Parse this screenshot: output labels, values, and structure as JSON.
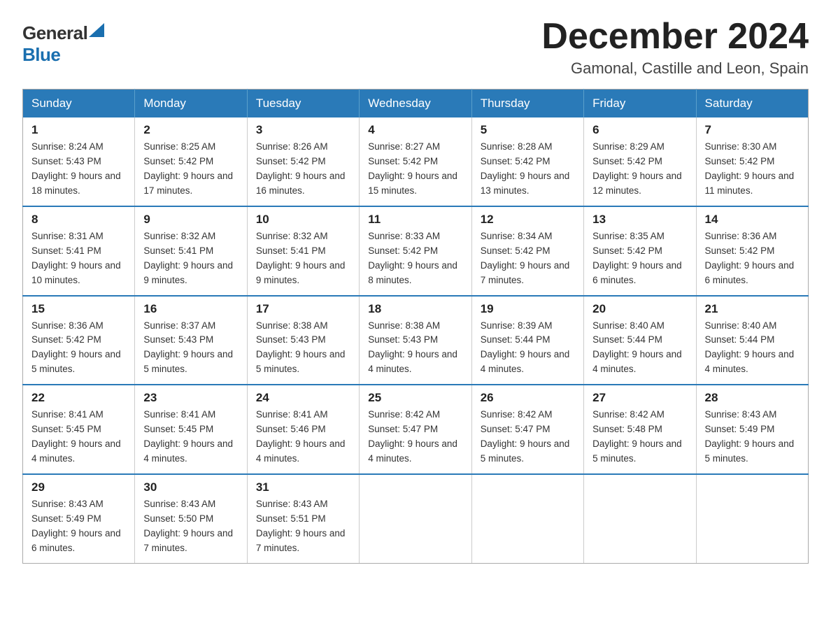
{
  "logo": {
    "general": "General",
    "blue": "Blue"
  },
  "title": "December 2024",
  "subtitle": "Gamonal, Castille and Leon, Spain",
  "days_of_week": [
    "Sunday",
    "Monday",
    "Tuesday",
    "Wednesday",
    "Thursday",
    "Friday",
    "Saturday"
  ],
  "weeks": [
    [
      {
        "num": "1",
        "sunrise": "8:24 AM",
        "sunset": "5:43 PM",
        "daylight": "9 hours and 18 minutes."
      },
      {
        "num": "2",
        "sunrise": "8:25 AM",
        "sunset": "5:42 PM",
        "daylight": "9 hours and 17 minutes."
      },
      {
        "num": "3",
        "sunrise": "8:26 AM",
        "sunset": "5:42 PM",
        "daylight": "9 hours and 16 minutes."
      },
      {
        "num": "4",
        "sunrise": "8:27 AM",
        "sunset": "5:42 PM",
        "daylight": "9 hours and 15 minutes."
      },
      {
        "num": "5",
        "sunrise": "8:28 AM",
        "sunset": "5:42 PM",
        "daylight": "9 hours and 13 minutes."
      },
      {
        "num": "6",
        "sunrise": "8:29 AM",
        "sunset": "5:42 PM",
        "daylight": "9 hours and 12 minutes."
      },
      {
        "num": "7",
        "sunrise": "8:30 AM",
        "sunset": "5:42 PM",
        "daylight": "9 hours and 11 minutes."
      }
    ],
    [
      {
        "num": "8",
        "sunrise": "8:31 AM",
        "sunset": "5:41 PM",
        "daylight": "9 hours and 10 minutes."
      },
      {
        "num": "9",
        "sunrise": "8:32 AM",
        "sunset": "5:41 PM",
        "daylight": "9 hours and 9 minutes."
      },
      {
        "num": "10",
        "sunrise": "8:32 AM",
        "sunset": "5:41 PM",
        "daylight": "9 hours and 9 minutes."
      },
      {
        "num": "11",
        "sunrise": "8:33 AM",
        "sunset": "5:42 PM",
        "daylight": "9 hours and 8 minutes."
      },
      {
        "num": "12",
        "sunrise": "8:34 AM",
        "sunset": "5:42 PM",
        "daylight": "9 hours and 7 minutes."
      },
      {
        "num": "13",
        "sunrise": "8:35 AM",
        "sunset": "5:42 PM",
        "daylight": "9 hours and 6 minutes."
      },
      {
        "num": "14",
        "sunrise": "8:36 AM",
        "sunset": "5:42 PM",
        "daylight": "9 hours and 6 minutes."
      }
    ],
    [
      {
        "num": "15",
        "sunrise": "8:36 AM",
        "sunset": "5:42 PM",
        "daylight": "9 hours and 5 minutes."
      },
      {
        "num": "16",
        "sunrise": "8:37 AM",
        "sunset": "5:43 PM",
        "daylight": "9 hours and 5 minutes."
      },
      {
        "num": "17",
        "sunrise": "8:38 AM",
        "sunset": "5:43 PM",
        "daylight": "9 hours and 5 minutes."
      },
      {
        "num": "18",
        "sunrise": "8:38 AM",
        "sunset": "5:43 PM",
        "daylight": "9 hours and 4 minutes."
      },
      {
        "num": "19",
        "sunrise": "8:39 AM",
        "sunset": "5:44 PM",
        "daylight": "9 hours and 4 minutes."
      },
      {
        "num": "20",
        "sunrise": "8:40 AM",
        "sunset": "5:44 PM",
        "daylight": "9 hours and 4 minutes."
      },
      {
        "num": "21",
        "sunrise": "8:40 AM",
        "sunset": "5:44 PM",
        "daylight": "9 hours and 4 minutes."
      }
    ],
    [
      {
        "num": "22",
        "sunrise": "8:41 AM",
        "sunset": "5:45 PM",
        "daylight": "9 hours and 4 minutes."
      },
      {
        "num": "23",
        "sunrise": "8:41 AM",
        "sunset": "5:45 PM",
        "daylight": "9 hours and 4 minutes."
      },
      {
        "num": "24",
        "sunrise": "8:41 AM",
        "sunset": "5:46 PM",
        "daylight": "9 hours and 4 minutes."
      },
      {
        "num": "25",
        "sunrise": "8:42 AM",
        "sunset": "5:47 PM",
        "daylight": "9 hours and 4 minutes."
      },
      {
        "num": "26",
        "sunrise": "8:42 AM",
        "sunset": "5:47 PM",
        "daylight": "9 hours and 5 minutes."
      },
      {
        "num": "27",
        "sunrise": "8:42 AM",
        "sunset": "5:48 PM",
        "daylight": "9 hours and 5 minutes."
      },
      {
        "num": "28",
        "sunrise": "8:43 AM",
        "sunset": "5:49 PM",
        "daylight": "9 hours and 5 minutes."
      }
    ],
    [
      {
        "num": "29",
        "sunrise": "8:43 AM",
        "sunset": "5:49 PM",
        "daylight": "9 hours and 6 minutes."
      },
      {
        "num": "30",
        "sunrise": "8:43 AM",
        "sunset": "5:50 PM",
        "daylight": "9 hours and 7 minutes."
      },
      {
        "num": "31",
        "sunrise": "8:43 AM",
        "sunset": "5:51 PM",
        "daylight": "9 hours and 7 minutes."
      },
      null,
      null,
      null,
      null
    ]
  ]
}
